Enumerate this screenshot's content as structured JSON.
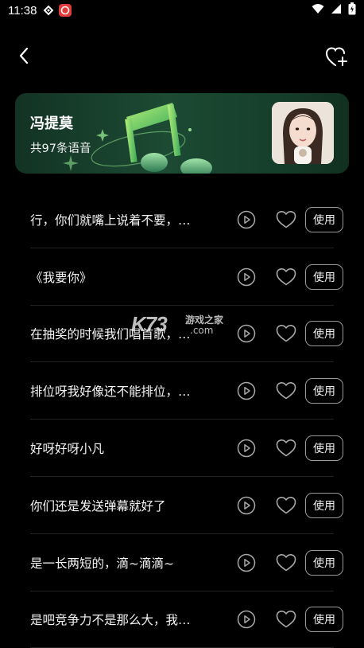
{
  "status_bar": {
    "time": "11:38"
  },
  "banner": {
    "name": "冯提莫",
    "count_label": "共97条语音"
  },
  "rows": [
    {
      "title": "行，你们就嘴上说着不要，…",
      "use_label": "使用"
    },
    {
      "title": "《我要你》",
      "use_label": "使用"
    },
    {
      "title": "在抽奖的时候我们唱首歌，…",
      "use_label": "使用"
    },
    {
      "title": "排位呀我好像还不能排位，…",
      "use_label": "使用"
    },
    {
      "title": "好呀好呀小凡",
      "use_label": "使用"
    },
    {
      "title": "你们还是发送弹幕就好了",
      "use_label": "使用"
    },
    {
      "title": "是一长两短的，滴~滴滴~",
      "use_label": "使用"
    },
    {
      "title": "是吧竞争力不是那么大，我…",
      "use_label": "使用"
    }
  ],
  "watermark": {
    "brand": "K73",
    "cn": "游戏之家",
    "domain": ".com"
  },
  "colors": {
    "background": "#000000",
    "banner_green": "#1c4a33",
    "accent_music_note": "#6fd06a"
  },
  "icons": {
    "back": "chevron-left-icon",
    "favorite_add": "heart-plus-icon",
    "play": "play-circle-icon",
    "like": "heart-outline-icon"
  }
}
